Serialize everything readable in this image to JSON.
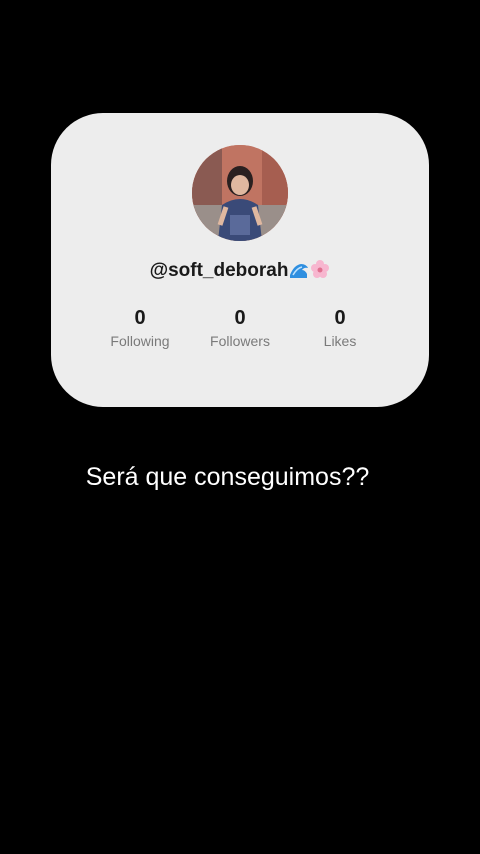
{
  "profile": {
    "handle": "@soft_deborah",
    "emoji_1": "wave-emoji",
    "emoji_2": "cherry-blossom-emoji"
  },
  "stats": {
    "following_value": "0",
    "following_label": "Following",
    "followers_value": "0",
    "followers_label": "Followers",
    "likes_value": "0",
    "likes_label": "Likes"
  },
  "caption": "Será que conseguimos??",
  "colors": {
    "background": "#000000",
    "card": "#ededed",
    "text_dark": "#1a1a1a",
    "label_gray": "#7a7a7a",
    "caption": "#ffffff"
  }
}
